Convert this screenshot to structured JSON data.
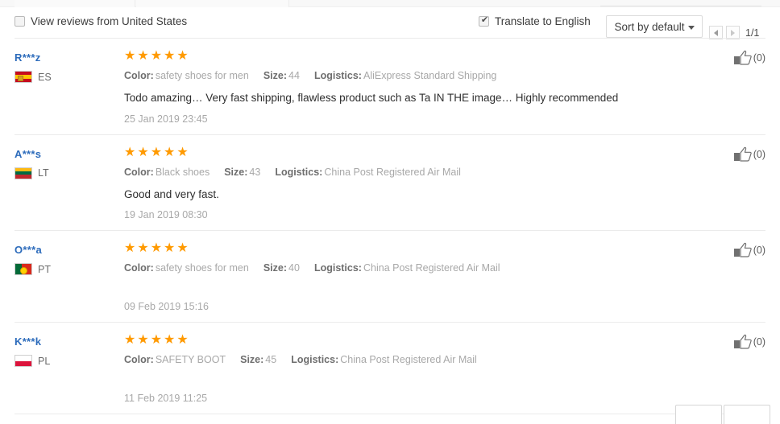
{
  "toolbar": {
    "view_reviews_label": "View reviews from United States",
    "view_reviews_checked": false,
    "translate_label": "Translate to English",
    "translate_checked": true,
    "sort_label": "Sort by default",
    "pagination": "1/1",
    "prev_icon": "triangle-left-icon",
    "next_icon": "triangle-right-icon",
    "caret_icon": "chevron-down-icon"
  },
  "colors": {
    "star": "#ff9a00",
    "username": "#2c6bbb",
    "label": "#6e6e6e",
    "value": "#a8a8a8",
    "divider": "#ebebeb"
  },
  "labels": {
    "color": "Color:",
    "size": "Size:",
    "logistics": "Logistics:"
  },
  "reviews": [
    {
      "username": "R***z",
      "country_code": "ES",
      "country_class": "ES",
      "stars": "★★★★★",
      "rating": 5,
      "color": "safety shoes for men",
      "size": "44",
      "logistics": "AliExpress Standard Shipping",
      "comment": "Todo amazing… Very fast shipping, flawless product such as Ta IN THE image… Highly recommended",
      "date": "25 Jan 2019 23:45",
      "helpful_count": "(0)"
    },
    {
      "username": "A***s",
      "country_code": "LT",
      "country_class": "LT",
      "stars": "★★★★★",
      "rating": 5,
      "color": "Black shoes",
      "size": "43",
      "logistics": "China Post Registered Air Mail",
      "comment": "Good and very fast.",
      "date": "19 Jan 2019 08:30",
      "helpful_count": "(0)"
    },
    {
      "username": "O***a",
      "country_code": "PT",
      "country_class": "PT",
      "stars": "★★★★★",
      "rating": 5,
      "color": "safety shoes for men",
      "size": "40",
      "logistics": "China Post Registered Air Mail",
      "comment": "",
      "date": "09 Feb 2019 15:16",
      "helpful_count": "(0)"
    },
    {
      "username": "K***k",
      "country_code": "PL",
      "country_class": "PL",
      "stars": "★★★★★",
      "rating": 5,
      "color": "SAFETY BOOT",
      "size": "45",
      "logistics": "China Post Registered Air Mail",
      "comment": "",
      "date": "11 Feb 2019 11:25",
      "helpful_count": "(0)"
    }
  ]
}
